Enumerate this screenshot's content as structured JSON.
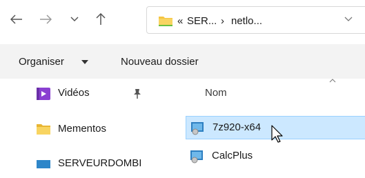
{
  "nav": {
    "back_icon": "arrow-left-icon",
    "forward_icon": "arrow-right-icon",
    "recent_icon": "chevron-down-icon",
    "up_icon": "arrow-up-icon"
  },
  "address": {
    "overflow": "«",
    "crumbs": [
      "SER...",
      "netlo..."
    ],
    "separator": "›"
  },
  "toolbar": {
    "organise_label": "Organiser",
    "new_folder_label": "Nouveau dossier"
  },
  "sidebar": {
    "items": [
      {
        "label": "Vidéos",
        "icon": "videos-folder-icon",
        "pinned": true
      },
      {
        "label": "Mementos",
        "icon": "folder-icon",
        "pinned": false
      },
      {
        "label": "SERVEURDOMBI",
        "icon": "network-drive-icon",
        "pinned": false
      }
    ]
  },
  "filelist": {
    "column_name": "Nom",
    "rows": [
      {
        "label": "7z920-x64",
        "selected": true
      },
      {
        "label": "CalcPlus",
        "selected": false
      }
    ]
  },
  "colors": {
    "selection_fill": "#cce8ff",
    "selection_border": "#99d1ff",
    "folder_yellow": "#f5c542",
    "toolbar_bg": "#f3f3f3"
  }
}
